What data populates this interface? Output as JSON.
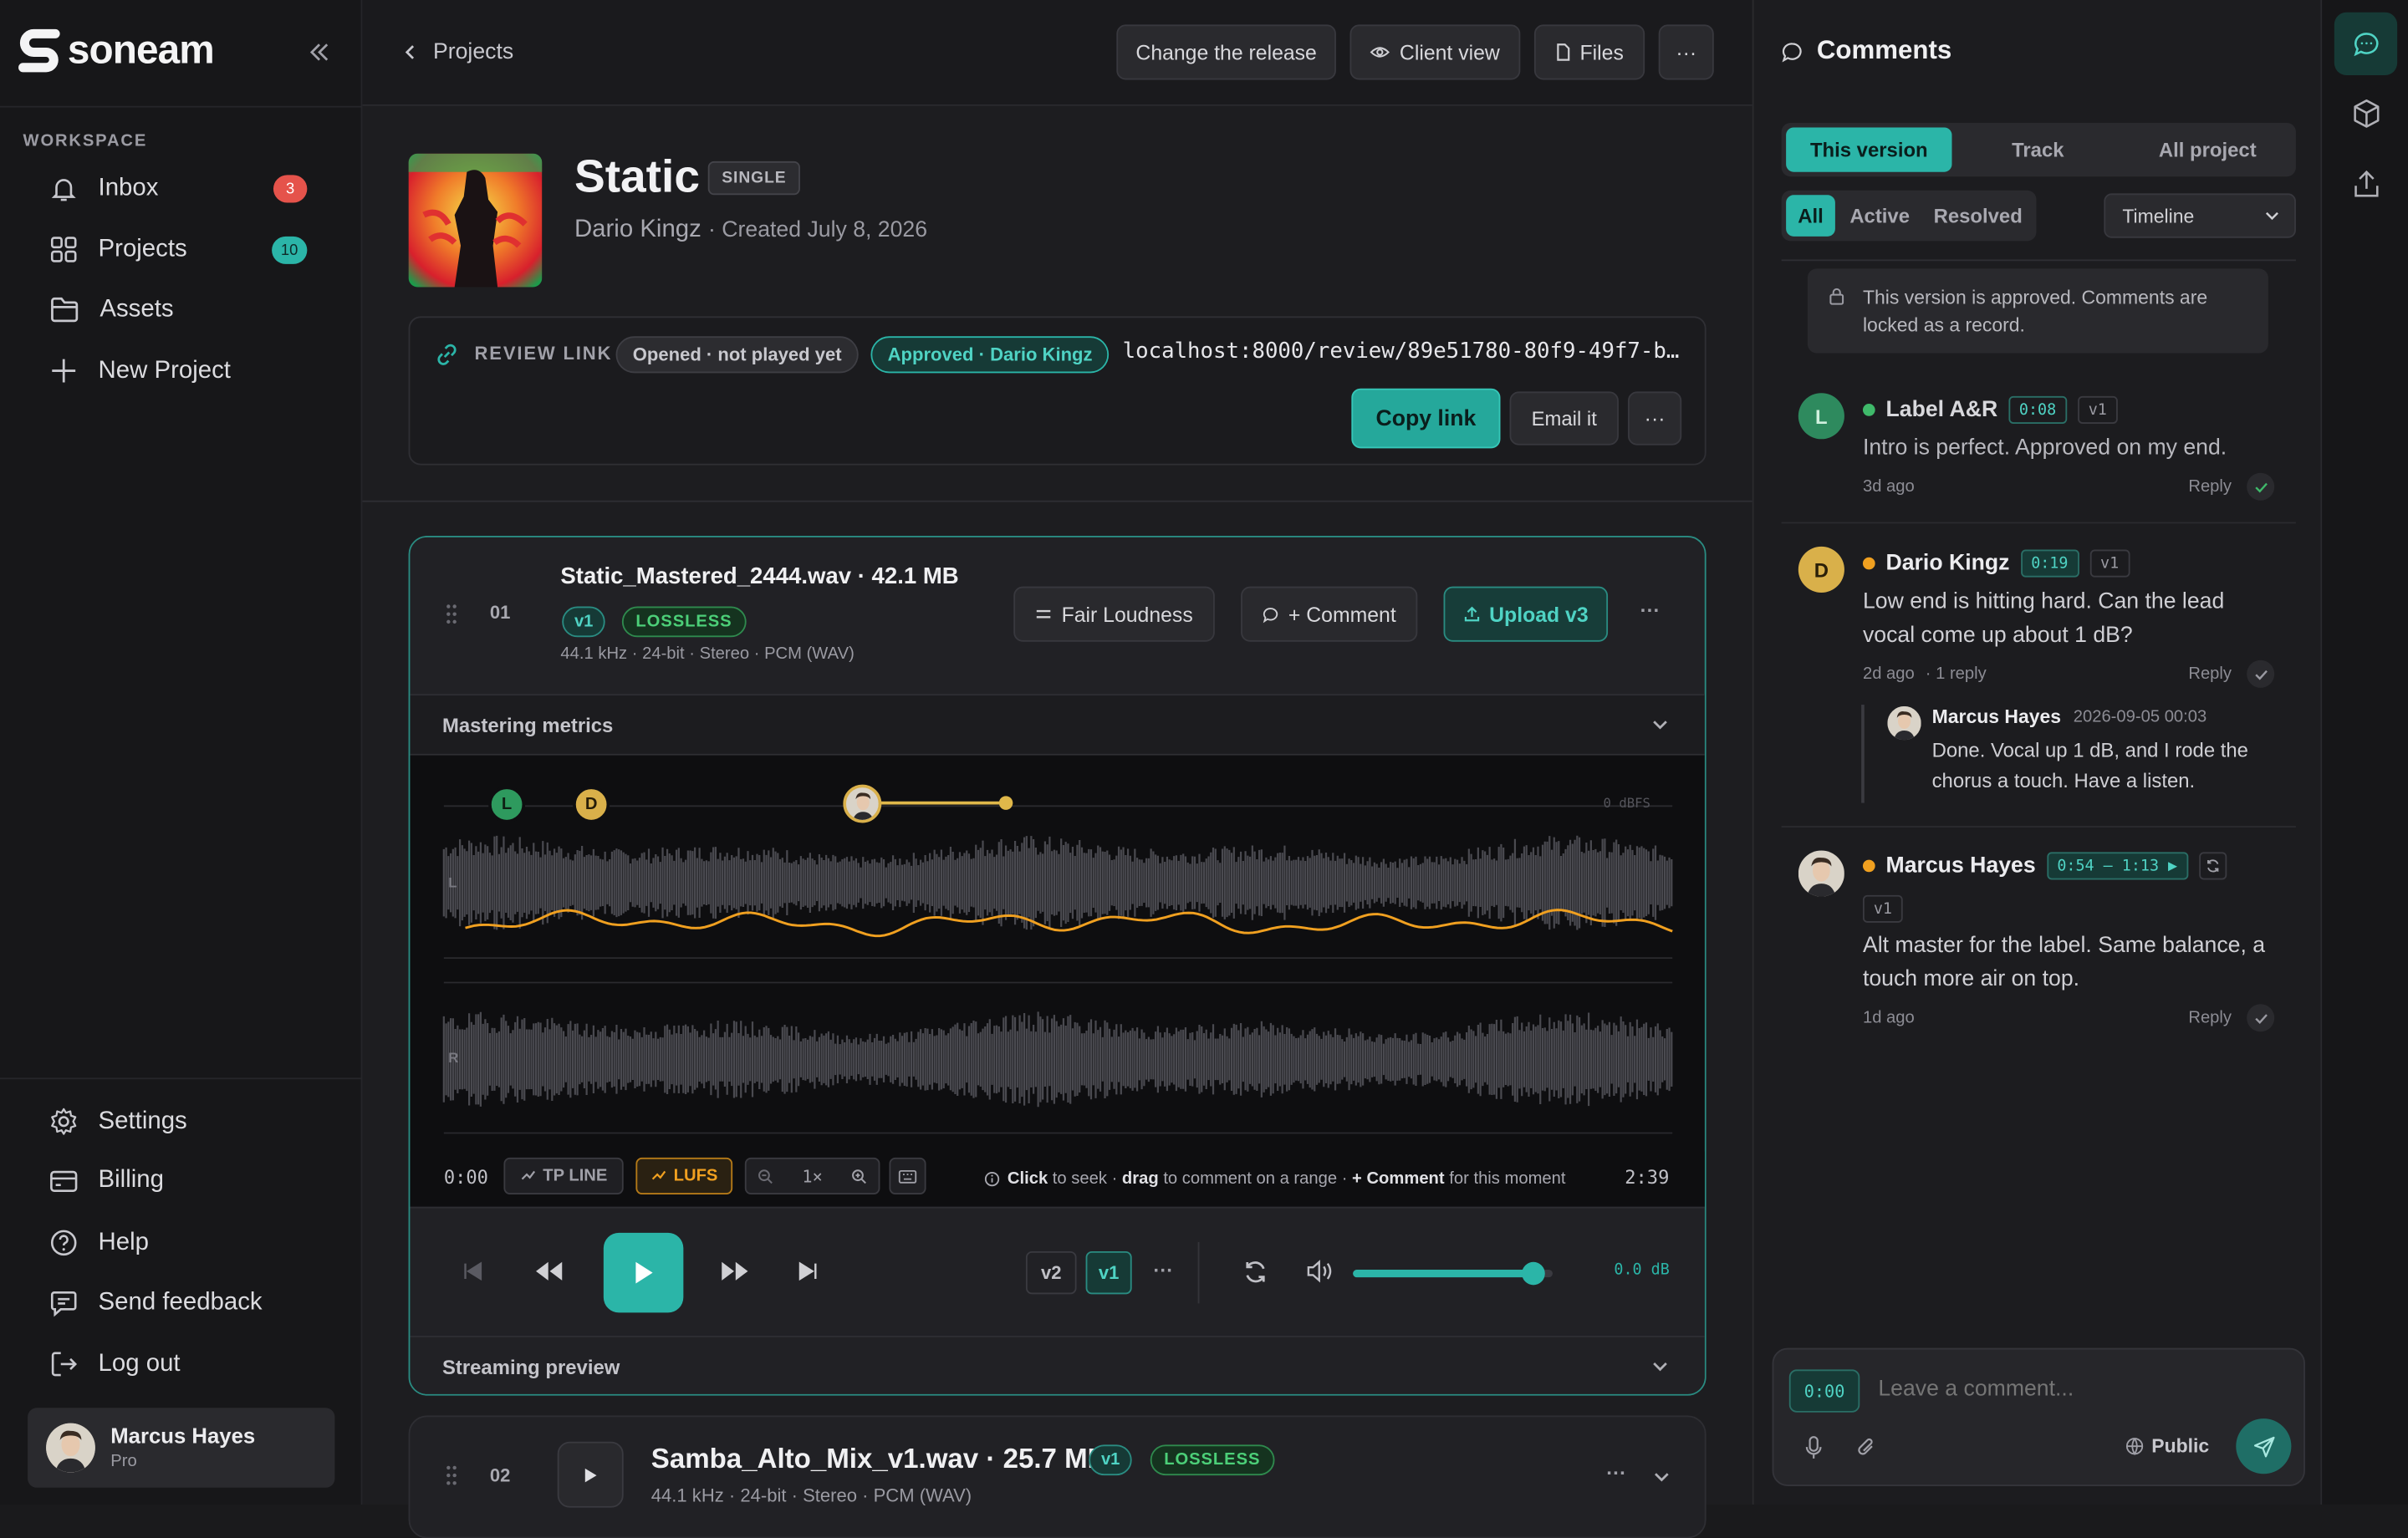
{
  "app": {
    "brand": "soneam",
    "accent": "#2bb5a8"
  },
  "sidebar": {
    "section_label": "WORKSPACE",
    "items": [
      {
        "label": "Inbox",
        "badge": "3",
        "icon": "bell-icon"
      },
      {
        "label": "Projects",
        "badge": "10",
        "icon": "grid-icon"
      },
      {
        "label": "Assets",
        "icon": "folder-icon"
      },
      {
        "label": "New Project",
        "icon": "plus-icon"
      }
    ],
    "bottom_items": [
      {
        "label": "Settings",
        "icon": "gear-icon"
      },
      {
        "label": "Billing",
        "icon": "card-icon"
      },
      {
        "label": "Help",
        "icon": "help-icon"
      },
      {
        "label": "Send feedback",
        "icon": "feedback-icon"
      },
      {
        "label": "Log out",
        "icon": "logout-icon"
      }
    ],
    "user": {
      "name": "Marcus Hayes",
      "plan": "Pro"
    }
  },
  "header": {
    "back_label": "Projects",
    "change_release": "Change the release",
    "client_view": "Client view",
    "files": "Files",
    "more": "···"
  },
  "release": {
    "title": "Static",
    "type_badge": "SINGLE",
    "artist": "Dario Kingz",
    "created": "· Created July 8, 2026",
    "review_label": "REVIEW LINK",
    "status_opened": "Opened · not played yet",
    "status_approved": "Approved · Dario Kingz",
    "url": "localhost:8000/review/89e51780-80f9-49f7-b…",
    "copy_link": "Copy link",
    "email_it": "Email it",
    "more": "···"
  },
  "track1": {
    "number": "01",
    "filename": "Static_Mastered_2444.wav · 42.1 MB",
    "version_chip": "v1",
    "lossless": "LOSSLESS",
    "specs": "44.1 kHz · 24-bit · Stereo · PCM (WAV)",
    "fair_loudness": "Fair Loudness",
    "comment": "+ Comment",
    "upload": "Upload v3",
    "metrics_label": "Mastering metrics",
    "markers": [
      "L",
      "D"
    ],
    "dbfs_label": "0 dBFS",
    "channel_left": "L",
    "channel_right": "R",
    "time_start": "0:00",
    "time_end": "2:39",
    "tp_line": "TP LINE",
    "lufs": "LUFS",
    "zoom": "1×",
    "hint_click": "Click",
    "hint_1": " to seek · ",
    "hint_drag": "drag",
    "hint_2": " to comment on a range · ",
    "hint_comment": "+ Comment",
    "hint_3": " for this moment",
    "version_a": "v2",
    "version_b": "v1",
    "volume_db": "0.0 dB",
    "volume_level": 0.9,
    "streaming_label": "Streaming preview"
  },
  "track2": {
    "number": "02",
    "filename": "Samba_Alto_Mix_v1.wav · 25.7 MB",
    "version_chip": "v1",
    "lossless": "LOSSLESS",
    "specs": "44.1 kHz · 24-bit · Stereo · PCM (WAV)"
  },
  "comments": {
    "title": "Comments",
    "tabs": [
      "This version",
      "Track",
      "All project"
    ],
    "filters": [
      "All",
      "Active",
      "Resolved"
    ],
    "sort": "Timeline",
    "locked_notice": "This version is approved. Comments are locked as a record.",
    "items": [
      {
        "initial": "L",
        "author": "Label A&R",
        "time": "0:08",
        "version": "v1",
        "body": "Intro is perfect. Approved on my end.",
        "ago": "3d ago",
        "reply": "Reply",
        "status_color": "#3fb96a"
      },
      {
        "initial": "D",
        "author": "Dario Kingz",
        "time": "0:19",
        "version": "v1",
        "body": "Low end is hitting hard. Can the lead vocal come up about 1 dB?",
        "ago": "2d ago",
        "replies": "· 1 reply",
        "reply": "Reply",
        "status_color": "#f0a020",
        "thread": {
          "author": "Marcus Hayes",
          "date": "2026-09-05 00:03",
          "body": "Done. Vocal up 1 dB, and I rode the chorus a touch. Have a listen."
        }
      },
      {
        "author": "Marcus Hayes",
        "time": "0:54 – 1:13 ▶",
        "version": "v1",
        "body": "Alt master for the label. Same balance, a touch more air on top.",
        "ago": "1d ago",
        "reply": "Reply",
        "status_color": "#f0a020"
      }
    ],
    "composer": {
      "time": "0:00",
      "placeholder": "Leave a comment...",
      "visibility": "Public"
    }
  }
}
